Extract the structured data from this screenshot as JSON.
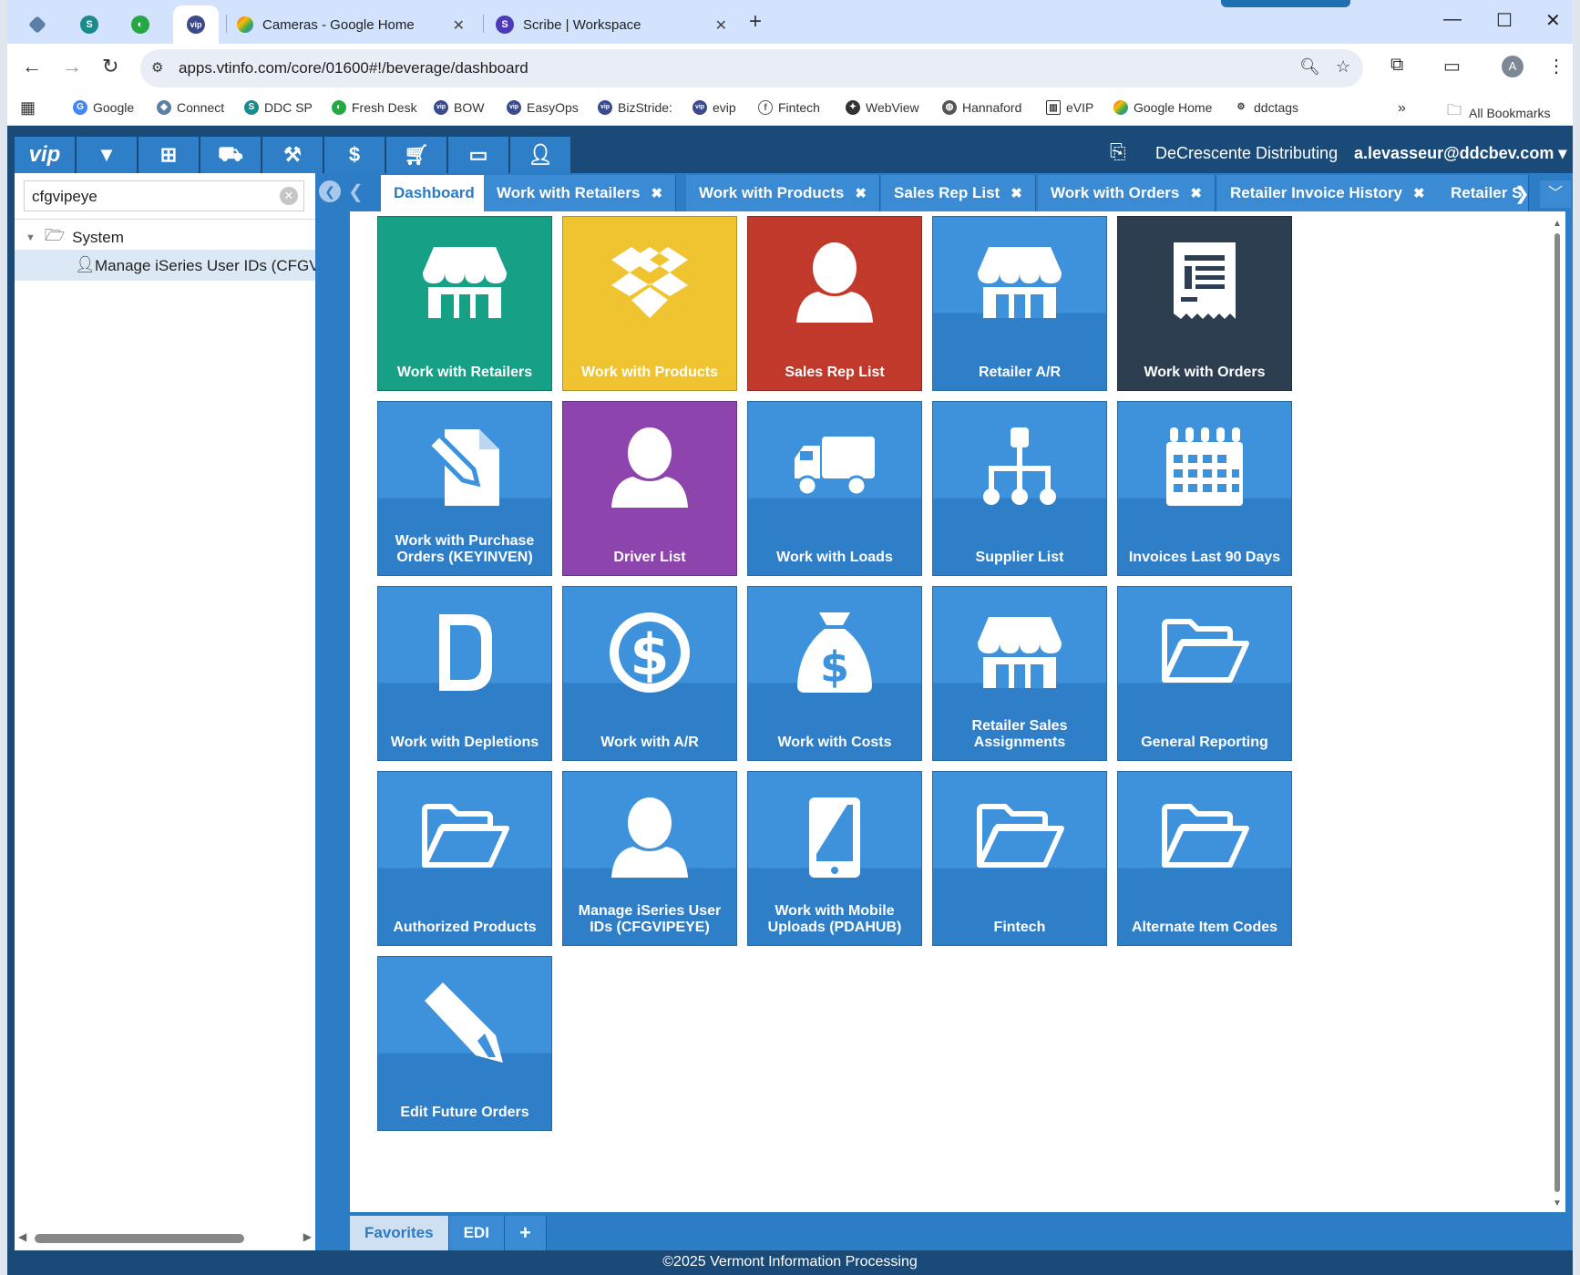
{
  "browser": {
    "tabs": [
      {
        "title": ""
      },
      {
        "title": ""
      },
      {
        "title": ""
      },
      {
        "title": ""
      },
      {
        "title": "Cameras - Google Home"
      },
      {
        "title": "Scribe | Workspace"
      }
    ],
    "url": "apps.vtinfo.com/core/01600#!/beverage/dashboard",
    "avatar_letter": "A",
    "bookmarks": [
      "Google",
      "Connect",
      "DDC SP",
      "Fresh Desk",
      "BOW",
      "EasyOps",
      "BizStride:",
      "evip",
      "Fintech",
      "WebView",
      "Hannaford",
      "eVIP",
      "Google Home",
      "ddctags"
    ],
    "all_bookmarks": "All Bookmarks"
  },
  "app": {
    "logo": "vip",
    "company": "DeCrescente Distributing",
    "user": "a.levasseur@ddcbev.com",
    "modules": [
      "vip",
      "beverage-icon",
      "binoculars-icon",
      "truck-icon",
      "wrench-icon",
      "dollar-icon",
      "cart-icon",
      "presentation-icon",
      "user-admin-icon"
    ],
    "sidebar": {
      "search_value": "cfgvipeye",
      "tree_root": "System",
      "tree_item": "Manage iSeries User IDs (CFGVIPEYE)"
    },
    "tabs": [
      {
        "label": "Dashboard",
        "closable": false
      },
      {
        "label": "Work with Retailers",
        "closable": true
      },
      {
        "label": "Work with Products",
        "closable": true
      },
      {
        "label": "Sales Rep List",
        "closable": true
      },
      {
        "label": "Work with Orders",
        "closable": true
      },
      {
        "label": "Retailer Invoice History",
        "closable": true
      },
      {
        "label": "Retailer S",
        "closable": false
      }
    ],
    "tiles": [
      {
        "label": "Work with Retailers",
        "icon": "store-icon",
        "color": "#16a085"
      },
      {
        "label": "Work with Products",
        "icon": "box-icon",
        "color": "#f0c330"
      },
      {
        "label": "Sales Rep List",
        "icon": "person-icon",
        "color": "#c0392b"
      },
      {
        "label": "Retailer A/R",
        "icon": "store-icon",
        "color": ""
      },
      {
        "label": "Work with Orders",
        "icon": "receipt-icon",
        "color": "#2c3e50"
      },
      {
        "label": "Work with Purchase Orders (KEYINVEN)",
        "icon": "document-edit-icon",
        "color": ""
      },
      {
        "label": "Driver List",
        "icon": "person-icon",
        "color": "#8e44ad"
      },
      {
        "label": "Work with Loads",
        "icon": "truck-icon",
        "color": ""
      },
      {
        "label": "Supplier List",
        "icon": "hierarchy-icon",
        "color": ""
      },
      {
        "label": "Invoices Last 90 Days",
        "icon": "calendar-icon",
        "color": ""
      },
      {
        "label": "Work with Depletions",
        "icon": "letter-d-icon",
        "color": ""
      },
      {
        "label": "Work with A/R",
        "icon": "dollar-circle-icon",
        "color": ""
      },
      {
        "label": "Work with Costs",
        "icon": "money-bag-icon",
        "color": ""
      },
      {
        "label": "Retailer Sales Assignments",
        "icon": "store-icon",
        "color": ""
      },
      {
        "label": "General Reporting",
        "icon": "folder-open-icon",
        "color": ""
      },
      {
        "label": "Authorized Products",
        "icon": "folder-open-icon",
        "color": ""
      },
      {
        "label": "Manage iSeries User IDs (CFGVIPEYE)",
        "icon": "person-icon",
        "color": ""
      },
      {
        "label": "Work with Mobile Uploads (PDAHUB)",
        "icon": "tablet-icon",
        "color": ""
      },
      {
        "label": "Fintech",
        "icon": "folder-open-icon",
        "color": ""
      },
      {
        "label": "Alternate Item Codes",
        "icon": "folder-open-icon",
        "color": ""
      },
      {
        "label": "Edit Future Orders",
        "icon": "pencil-icon",
        "color": ""
      }
    ],
    "bottom_tabs": [
      "Favorites",
      "EDI",
      "+"
    ],
    "footer": "©2025 Vermont Information Processing"
  }
}
